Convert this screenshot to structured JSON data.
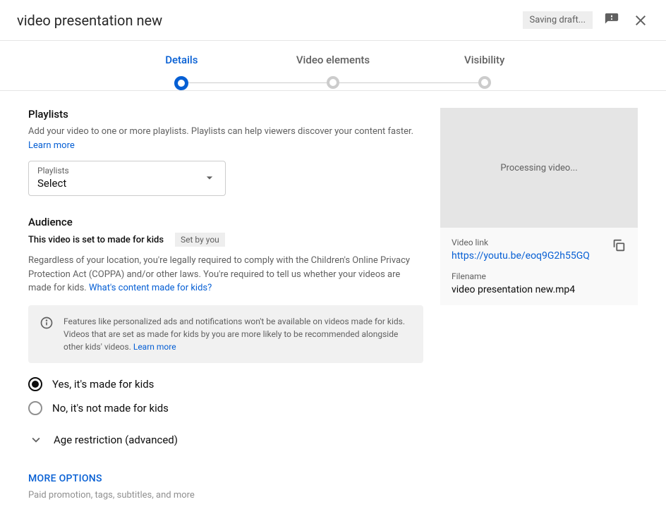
{
  "header": {
    "title": "video presentation new",
    "saving": "Saving draft..."
  },
  "stepper": {
    "steps": [
      "Details",
      "Video elements",
      "Visibility"
    ],
    "active": 0
  },
  "playlists": {
    "title": "Playlists",
    "desc": "Add your video to one or more playlists. Playlists can help viewers discover your content faster. ",
    "learn_more": "Learn more",
    "select_label": "Playlists",
    "select_value": "Select"
  },
  "audience": {
    "title": "Audience",
    "subtitle": "This video is set to made for kids",
    "set_by": "Set by you",
    "desc": "Regardless of your location, you're legally required to comply with the Children's Online Privacy Protection Act (COPPA) and/or other laws. You're required to tell us whether your videos are made for kids. ",
    "whats_link": "What's content made for kids?",
    "info_text": "Features like personalized ads and notifications won't be available on videos made for kids. Videos that are set as made for kids by you are more likely to be recommended alongside other kids' videos. ",
    "info_learn": "Learn more",
    "radio_yes": "Yes, it's made for kids",
    "radio_no": "No, it's not made for kids",
    "expand_label": "Age restriction (advanced)"
  },
  "more": {
    "title": "MORE OPTIONS",
    "desc": "Paid promotion, tags, subtitles, and more"
  },
  "preview": {
    "processing": "Processing video...",
    "link_label": "Video link",
    "link_value": "https://youtu.be/eoq9G2h55GQ",
    "file_label": "Filename",
    "file_value": "video presentation new.mp4"
  }
}
